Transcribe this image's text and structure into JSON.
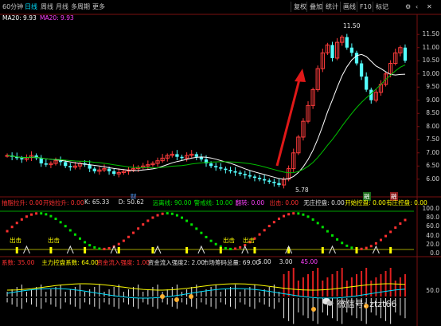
{
  "toolbar": {
    "tabs": [
      "60分钟",
      "日线",
      "周线",
      "月线",
      "多周期",
      "更多"
    ],
    "active_tab": "日线",
    "buttons": [
      "复权",
      "叠加",
      "统计",
      "画线",
      "F10",
      "标记"
    ]
  },
  "indicator_main": {
    "ma20_a": "MA20: 9.93",
    "ma20_b": "MA20: 9.93",
    "ma20_a_color": "#ffffff",
    "ma20_b_color": "#ff40ff"
  },
  "price_axis": [
    "11.50",
    "11.00",
    "10.50",
    "10.00",
    "9.50",
    "9.00",
    "8.50",
    "8.00",
    "7.50",
    "7.00",
    "6.50",
    "6.00"
  ],
  "annotations": {
    "high_label": "11.50",
    "low_label": "5.78",
    "marker_cai": "财",
    "marker_right_1": "融",
    "marker_right_2": "融"
  },
  "indicator_mid": {
    "items": [
      {
        "text": "抽脂拉升: 0.00",
        "color": "#ff3030"
      },
      {
        "text": "开始拉升: 0.00",
        "color": "#ff3030"
      },
      {
        "text": "K: 65.33",
        "color": "#e0e0e0"
      },
      {
        "text": "D: 50.62",
        "color": "#e0e0e0"
      },
      {
        "text": "远离线: 90.00",
        "color": "#00e000"
      },
      {
        "text": "警戒线: 10.00",
        "color": "#00e000"
      },
      {
        "text": "翻转: 0.00",
        "color": "#ff40ff"
      },
      {
        "text": "出击: 0.00",
        "color": "#ff3030"
      },
      {
        "text": "无庄控盘: 0.00",
        "color": "#e0e0e0"
      },
      {
        "text": "开始控盘: 0.00",
        "color": "#ffff00"
      },
      {
        "text": "有庄控盘: 0.00",
        "color": "#ffff00"
      }
    ],
    "axis": [
      "100.0",
      "80.0",
      "60.0",
      "40.0",
      "20.0",
      "0.0"
    ],
    "tags": [
      "出击",
      "出击",
      "出击",
      "出击"
    ]
  },
  "indicator_bottom": {
    "items": [
      {
        "text": "系数: 35.00",
        "color": "#ff3030"
      },
      {
        "text": "主力控盘系数: 64.00",
        "color": "#ffff00"
      },
      {
        "text": "资金流入强度: 1.00",
        "color": "#ff3030"
      },
      {
        "text": "资金流入强度2: 2.00",
        "color": "#e0e0e0"
      },
      {
        "text": "市场筹码总量: 69.00",
        "color": "#e0e0e0"
      },
      {
        "text": "5.00",
        "color": "#e0e0e0"
      },
      {
        "text": "3.00",
        "color": "#e0e0e0"
      },
      {
        "text": "45.00",
        "color": "#ff40ff"
      }
    ],
    "axis": [
      "50.0"
    ]
  },
  "watermark": "微信号: ztzt66",
  "chart_data": {
    "type": "candlestick",
    "title": "",
    "price_range": [
      5.6,
      11.9
    ],
    "candles_close": [
      6.9,
      6.85,
      6.8,
      6.75,
      6.82,
      6.9,
      6.8,
      6.6,
      6.55,
      6.6,
      6.7,
      6.65,
      6.5,
      6.45,
      6.5,
      6.6,
      6.55,
      6.4,
      6.3,
      6.35,
      6.4,
      6.3,
      6.2,
      6.25,
      6.3,
      6.35,
      6.4,
      6.45,
      6.5,
      6.55,
      6.6,
      6.7,
      6.8,
      6.9,
      6.95,
      6.85,
      6.8,
      6.9,
      6.95,
      6.85,
      6.75,
      6.6,
      6.5,
      6.45,
      6.4,
      6.35,
      6.3,
      6.25,
      6.2,
      6.15,
      6.1,
      6.05,
      6.0,
      5.95,
      5.9,
      5.85,
      5.78,
      6.0,
      6.4,
      7.0,
      7.6,
      8.2,
      8.8,
      9.4,
      10.2,
      10.8,
      11.1,
      10.6,
      11.2,
      11.4,
      11.0,
      10.8,
      10.4,
      9.9,
      9.4,
      9.0,
      9.3,
      9.6,
      10.0,
      10.4,
      10.8,
      11.0,
      10.5
    ]
  }
}
